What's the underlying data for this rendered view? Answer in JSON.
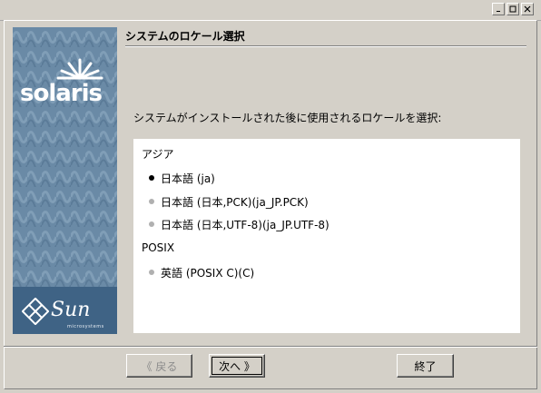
{
  "window": {
    "title": "",
    "controls": [
      "minimize-icon",
      "restore-icon",
      "close-icon"
    ]
  },
  "banner": {
    "product_logo": "solaris",
    "vendor_logo": "Sun",
    "vendor_sub": "microsystems"
  },
  "page": {
    "title": "システムのロケール選択",
    "prompt": "システムがインストールされた後に使用されるロケールを選択:"
  },
  "locale_groups": [
    {
      "label": "アジア",
      "items": [
        {
          "label": "日本語 (ja)",
          "selected": true
        },
        {
          "label": "日本語 (日本,PCK)(ja_JP.PCK)",
          "selected": false
        },
        {
          "label": "日本語 (日本,UTF-8)(ja_JP.UTF-8)",
          "selected": false
        }
      ]
    },
    {
      "label": "POSIX",
      "items": [
        {
          "label": "英語 (POSIX C)(C)",
          "selected": false
        }
      ]
    }
  ],
  "buttons": {
    "back": "《 戻る",
    "next": "次へ 》",
    "exit": "終了"
  },
  "colors": {
    "window_bg": "#d4d0c8",
    "banner": "#6a8aa6",
    "banner_dark": "#3f6385",
    "list_bg": "#ffffff"
  }
}
